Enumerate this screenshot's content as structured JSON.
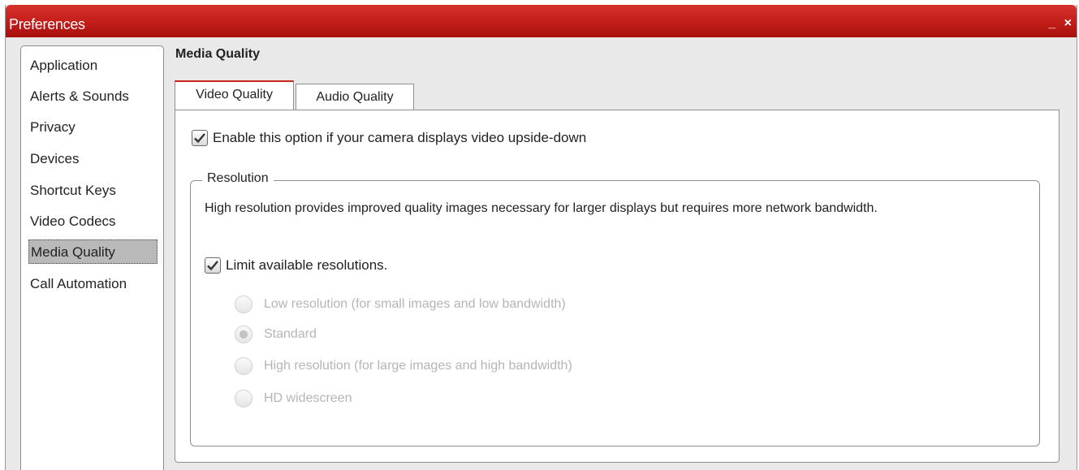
{
  "window": {
    "title": "Preferences",
    "minimize_label": "_",
    "close_label": "×"
  },
  "sidebar": {
    "items": [
      {
        "label": "Application"
      },
      {
        "label": "Alerts & Sounds"
      },
      {
        "label": "Privacy"
      },
      {
        "label": "Devices"
      },
      {
        "label": "Shortcut Keys"
      },
      {
        "label": "Video Codecs"
      },
      {
        "label": "Media Quality",
        "selected": true
      },
      {
        "label": "Call Automation"
      }
    ]
  },
  "main": {
    "section_title": "Media Quality",
    "tabs": [
      {
        "label": "Video Quality",
        "active": true
      },
      {
        "label": "Audio Quality",
        "active": false
      }
    ],
    "flip_video": {
      "label": "Enable this option if your camera displays video upside-down",
      "checked": true
    },
    "resolution": {
      "legend": "Resolution",
      "description": "High resolution provides improved quality images necessary for larger displays but requires more network bandwidth.",
      "limit": {
        "label": "Limit available resolutions.",
        "checked": true
      },
      "options": [
        {
          "label": "Low resolution (for small images and low bandwidth)",
          "selected": false,
          "enabled": false
        },
        {
          "label": "Standard",
          "selected": true,
          "enabled": false
        },
        {
          "label": "High resolution (for large images and high bandwidth)",
          "selected": false,
          "enabled": false
        },
        {
          "label": "HD widescreen",
          "selected": false,
          "enabled": false
        }
      ]
    }
  },
  "colors": {
    "titlebar": "#c8211d",
    "selected_item": "#b9b9b9",
    "disabled_text": "#b5b5b5"
  }
}
